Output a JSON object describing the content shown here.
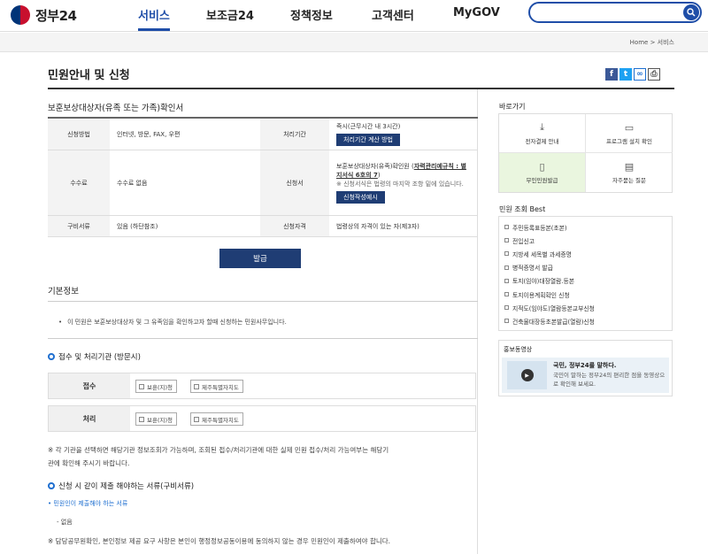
{
  "header": {
    "logo_text": "정부24",
    "nav": [
      "서비스",
      "보조금24",
      "정책정보",
      "고객센터",
      "MyGOV"
    ],
    "search_placeholder": ""
  },
  "breadcrumb": {
    "home": "Home",
    "sep": ">",
    "current": "서비스"
  },
  "page_title": "민원안내 및 신청",
  "doc_title": "보훈보상대상자(유족 또는 가족)확인서",
  "info_table": {
    "method_label": "신청방법",
    "method_value": "인터넷, 방문, FAX, 우편",
    "period_label": "처리기간",
    "period_value": "즉시(근무시간 내 3시간)",
    "period_btn": "처리기간 계산 방법",
    "fee_label": "수수료",
    "fee_value": "수수료 없음",
    "form_label": "신청서",
    "form_line1": "보훈보상대상자(유족)확인원 (",
    "form_link": "자력관리예규칙 : 별지서식 6호의 7",
    "form_line2": ")",
    "form_note": "※ 신청서식은 법령의 마지막 조항 밑에 있습니다.",
    "form_btn": "신청작성예시",
    "docs_label": "구비서류",
    "docs_value": "있음 (하단참조)",
    "qual_label": "신청자격",
    "qual_value": "법령상의 자격이 있는 자(제3자)"
  },
  "apply_btn": "발급",
  "basic_info": {
    "heading": "기본정보",
    "bullet": "이 민원은 보훈보상대상자 및 그 유족임을 확인하고자 할때 신청하는 민원사무입니다."
  },
  "org_section": {
    "heading": "접수 및 처리기관 (방문시)",
    "receive_label": "접수",
    "process_label": "처리",
    "orgs": [
      "보훈(지)청",
      "제주특별자치도"
    ],
    "note_line1": "※ 각 기관을 선택하면 해당기관 정보조회가 가능하며, 조회된 접수/처리기관에 대한 실제 민원 접수/처리 가능여부는 해당기",
    "note_line2": "관에 확인해 주시기 바랍니다."
  },
  "docs_section": {
    "heading": "신청 시 같이 제출 해야하는 서류(구비서류)",
    "sub": "• 민원인이 제출해야 하는 서류",
    "item": "- 없음",
    "note": "※ 담당공무원확인, 본인정보 제공 요구 사항은 본인이 행정정보공동이용에 동의하지 않는 경우 민원인이 제출하여야 합니다."
  },
  "sidebar": {
    "quick_title": "바로가기",
    "quick": [
      {
        "label": "전자결제 안내",
        "icon": "download-icon"
      },
      {
        "label": "프로그램 설치 확인",
        "icon": "monitor-icon"
      },
      {
        "label": "무인민원발급",
        "icon": "kiosk-icon"
      },
      {
        "label": "자주묻는 질문",
        "icon": "chat-icon"
      }
    ],
    "best_title": "민원 조회 Best",
    "best": [
      "주민등록표등본(초본)",
      "전입신고",
      "지방세 세목별 과세증명",
      "병적증명서 발급",
      "토지(임야)대장열람.등본",
      "토지이용계획확인 신청",
      "지적도(임야도)열람등본교부신청",
      "건축물대장등초본발급(열람)신청"
    ],
    "promo_title": "홍보동영상",
    "promo_heading": "국민, 정부24를 말하다.",
    "promo_desc": "국민이 말하는 정부24의 편리한 점을 동영상으로 확인해 보세요."
  },
  "colors": {
    "brand": "#1f4ea8",
    "navy_button": "#1f3d74",
    "kiosk_highlight": "#eaf6df"
  }
}
